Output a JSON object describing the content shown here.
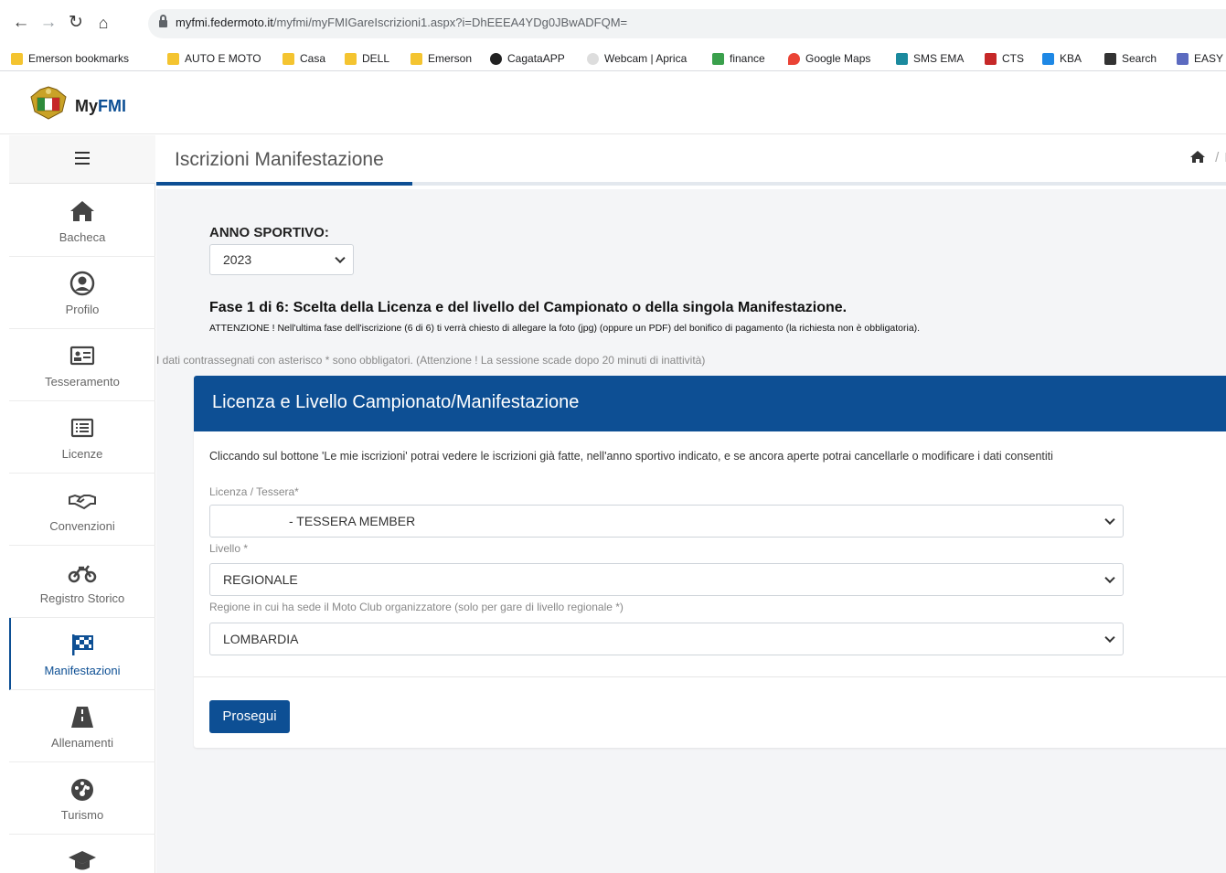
{
  "browser": {
    "url_host": "myfmi.federmoto.it",
    "url_path": "/myfmi/myFMIGareIscrizioni1.aspx?i=DhEEEA4YDg0JBwADFQM=",
    "bookmarks": [
      "Emerson bookmarks",
      "AUTO E MOTO",
      "Casa",
      "DELL",
      "Emerson",
      "CagataAPP",
      "Webcam | Aprica",
      "finance",
      "Google Maps",
      "SMS EMA",
      "CTS",
      "KBA",
      "Search",
      "EASY"
    ]
  },
  "app": {
    "brand_my": "My",
    "brand_fmi": "FMI"
  },
  "sidebar": {
    "items": [
      {
        "label": "Bacheca",
        "icon": "home-icon"
      },
      {
        "label": "Profilo",
        "icon": "user-circle-icon"
      },
      {
        "label": "Tesseramento",
        "icon": "id-card-icon"
      },
      {
        "label": "Licenze",
        "icon": "list-icon"
      },
      {
        "label": "Convenzioni",
        "icon": "handshake-icon"
      },
      {
        "label": "Registro Storico",
        "icon": "motorcycle-icon"
      },
      {
        "label": "Manifestazioni",
        "icon": "flag-checkered-icon"
      },
      {
        "label": "Allenamenti",
        "icon": "road-icon"
      },
      {
        "label": "Turismo",
        "icon": "tachometer-icon"
      },
      {
        "label": "",
        "icon": "graduation-cap-icon"
      }
    ],
    "active": "Manifestazioni"
  },
  "header": {
    "title": "Iscrizioni Manifestazione",
    "breadcrumb_sep": "/",
    "breadcrumb_tail": "I"
  },
  "form": {
    "anno_label": "ANNO SPORTIVO:",
    "anno_value": "2023",
    "fase": "Fase 1 di 6: Scelta della Licenza e del livello del Campionato o della singola Manifestazione.",
    "attenzione": "ATTENZIONE ! Nell'ultima fase dell'iscrizione (6 di 6) ti verrà chiesto di allegare la foto (jpg) (oppure un PDF) del bonifico di pagamento (la richiesta non è obbligatoria).",
    "obbligatori": "I dati contrassegnati con asterisco * sono obbligatori. (Attenzione ! La sessione scade dopo 20 minuti di inattività)",
    "card_title": "Licenza e Livello Campionato/Manifestazione",
    "card_info": "Cliccando sul bottone 'Le mie iscrizioni' potrai vedere le iscrizioni già fatte, nell'anno sportivo indicato, e se ancora aperte potrai cancellarle o modificare i dati consentiti",
    "licenza_label": "Licenza / Tessera*",
    "licenza_value": "- TESSERA MEMBER",
    "livello_label": "Livello *",
    "livello_value": "REGIONALE",
    "regione_label": "Regione in cui ha sede il Moto Club organizzatore (solo per gare di livello regionale *)",
    "regione_value": "LOMBARDIA",
    "prosegui_label": "Prosegui"
  },
  "colors": {
    "primary": "#0d4f94",
    "background": "#f4f5f7"
  }
}
